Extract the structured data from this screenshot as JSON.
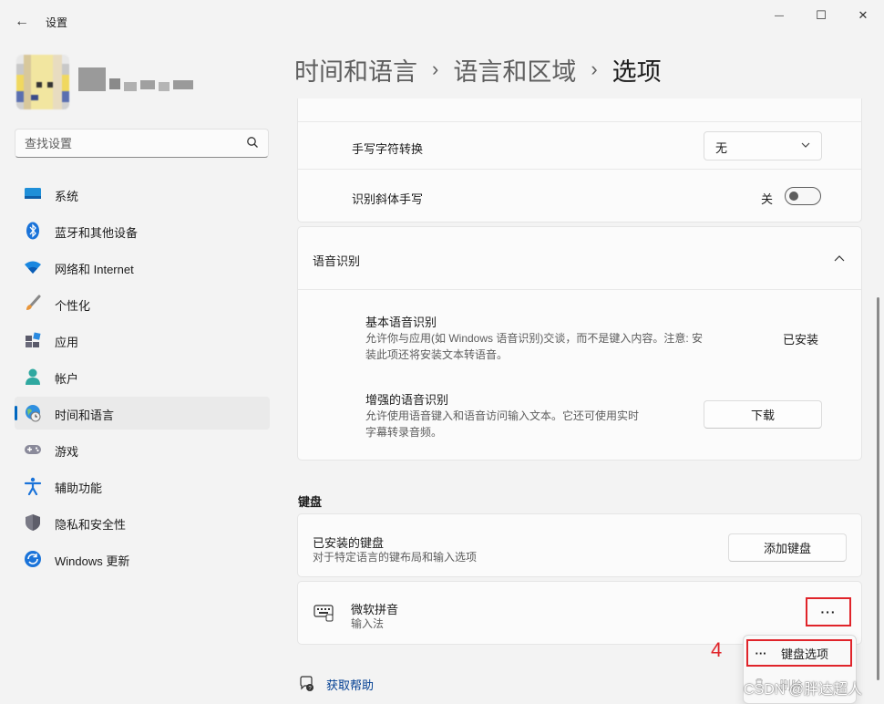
{
  "window": {
    "app_title": "设置",
    "back_glyph": "←",
    "minimize_glyph": "—",
    "maximize_glyph": "☐",
    "close_glyph": "✕"
  },
  "search": {
    "placeholder": "查找设置"
  },
  "sidebar": {
    "items": [
      {
        "label": "系统",
        "icon": "system-icon"
      },
      {
        "label": "蓝牙和其他设备",
        "icon": "bluetooth-icon"
      },
      {
        "label": "网络和 Internet",
        "icon": "wifi-icon"
      },
      {
        "label": "个性化",
        "icon": "brush-icon"
      },
      {
        "label": "应用",
        "icon": "apps-icon"
      },
      {
        "label": "帐户",
        "icon": "account-icon"
      },
      {
        "label": "时间和语言",
        "icon": "globe-clock-icon",
        "active": true
      },
      {
        "label": "游戏",
        "icon": "gamepad-icon"
      },
      {
        "label": "辅助功能",
        "icon": "accessibility-icon"
      },
      {
        "label": "隐私和安全性",
        "icon": "shield-icon"
      },
      {
        "label": "Windows 更新",
        "icon": "update-icon"
      }
    ]
  },
  "breadcrumb": {
    "level1": "时间和语言",
    "level2": "语言和区域",
    "current": "选项",
    "separator": "›"
  },
  "handwriting": {
    "convert_label": "手写字符转换",
    "convert_value": "无",
    "italic_label": "识别斜体手写",
    "italic_state": "关"
  },
  "speech": {
    "section_label": "语音识别",
    "basic_title": "基本语音识别",
    "basic_desc_line1": "允许你与应用(如 Windows 语音识别)交谈，而不是键入内容。注意: 安",
    "basic_desc_line2": "装此项还将安装文本转语音。",
    "basic_status": "已安装",
    "enhanced_title": "增强的语音识别",
    "enhanced_desc_line1": "允许使用语音键入和语音访问输入文本。它还可使用实时",
    "enhanced_desc_line2": "字幕转录音频。",
    "download_label": "下载"
  },
  "keyboard": {
    "section_title": "键盘",
    "installed_title": "已安装的键盘",
    "installed_desc": "对于特定语言的键布局和输入选项",
    "add_label": "添加键盘",
    "ime_name": "微软拼音",
    "ime_type": "输入法",
    "more_label": "···"
  },
  "context_menu": {
    "options_label": "键盘选项",
    "remove_label": "删除",
    "options_glyph": "···"
  },
  "annotation": {
    "step_number": "4"
  },
  "help": {
    "label": "获取帮助"
  },
  "watermark": {
    "text": "CSDN @胖达超人"
  },
  "colors": {
    "accent": "#0067c0",
    "highlight_box": "#e0242a",
    "link": "#003e92"
  }
}
